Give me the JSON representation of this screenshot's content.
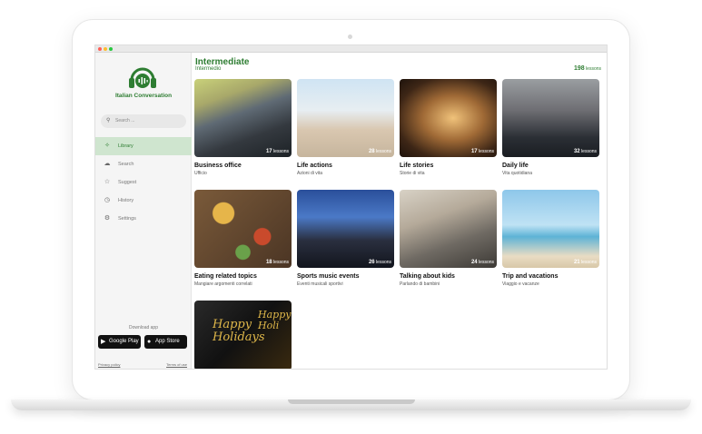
{
  "app": {
    "name": "Italian Conversation",
    "brand_color": "#2e7d32",
    "logo_icon": "headphones-chat-icon"
  },
  "sidebar": {
    "search_placeholder": "Search ...",
    "items": [
      {
        "label": "Library",
        "icon": "library-icon",
        "active": true
      },
      {
        "label": "Search",
        "icon": "search-cloud-icon",
        "active": false
      },
      {
        "label": "Suggest",
        "icon": "star-icon",
        "active": false
      },
      {
        "label": "History",
        "icon": "history-icon",
        "active": false
      },
      {
        "label": "Settings",
        "icon": "settings-icon",
        "active": false
      }
    ],
    "download_label": "Download app",
    "google_play_label": "Google Play",
    "app_store_label": "App Store",
    "privacy_label": "Privacy policy",
    "terms_label": "Terms of use"
  },
  "main": {
    "title": "Intermediate",
    "subtitle": "Intermedio",
    "lesson_total_number": "198",
    "lesson_total_unit": "lessons",
    "cards": [
      {
        "title": "Business office",
        "subtitle": "Ufficio",
        "count": "17",
        "unit": "lessons"
      },
      {
        "title": "Life actions",
        "subtitle": "Azioni di vita",
        "count": "28",
        "unit": "lessons"
      },
      {
        "title": "Life stories",
        "subtitle": "Storie di vita",
        "count": "17",
        "unit": "lessons"
      },
      {
        "title": "Daily life",
        "subtitle": "Vita quotidiana",
        "count": "32",
        "unit": "lessons"
      },
      {
        "title": "Eating related topics",
        "subtitle": "Mangiare argomenti correlati",
        "count": "18",
        "unit": "lessons"
      },
      {
        "title": "Sports music events",
        "subtitle": "Eventi musicali sportivi",
        "count": "26",
        "unit": "lessons"
      },
      {
        "title": "Talking about kids",
        "subtitle": "Parlando di bambini",
        "count": "24",
        "unit": "lessons"
      },
      {
        "title": "Trip and vacations",
        "subtitle": "Viaggio e vacanze",
        "count": "21",
        "unit": "lessons"
      },
      {
        "title": "",
        "subtitle": "",
        "count": "",
        "unit": ""
      }
    ]
  }
}
